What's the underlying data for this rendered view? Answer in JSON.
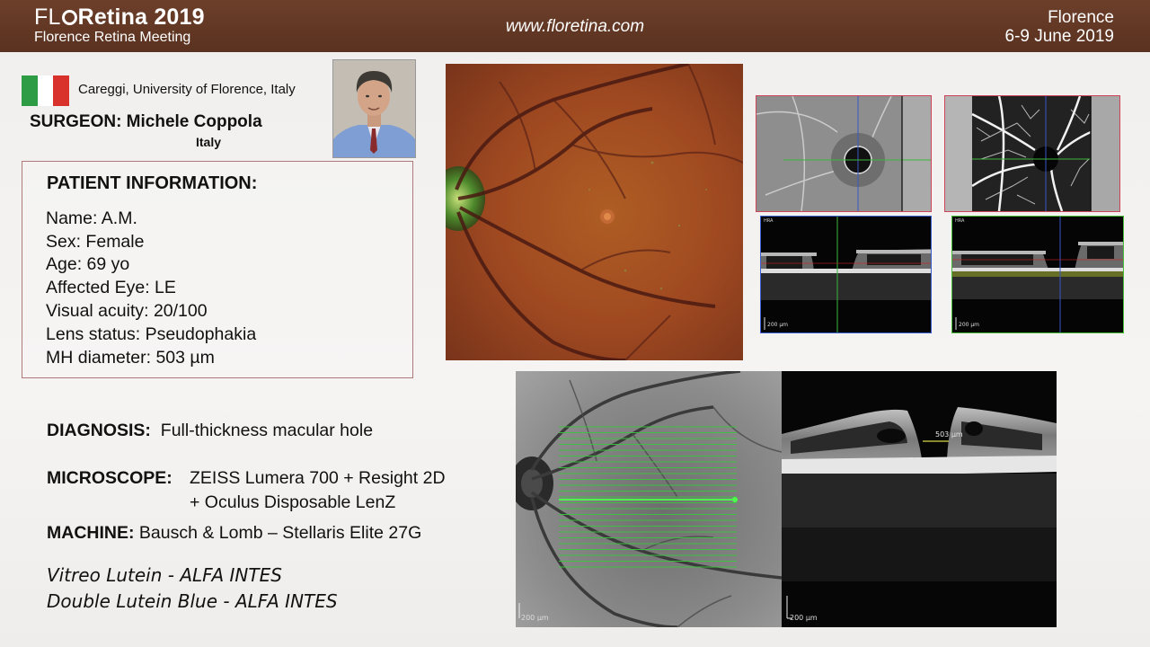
{
  "header": {
    "logo_prefix": "FL",
    "logo_o": "O",
    "logo_suffix": "Retina 2019",
    "logo_subtitle": "Florence Retina Meeting",
    "website": "www.floretina.com",
    "city": "Florence",
    "dates": "6-9 June 2019"
  },
  "presenter": {
    "institution": "Careggi, University of Florence, Italy",
    "surgeon": "SURGEON: Michele Coppola",
    "country": "Italy",
    "flag_colors": [
      "#2e9b45",
      "#ffffff",
      "#d9312b"
    ]
  },
  "patient": {
    "title": "PATIENT INFORMATION:",
    "lines": [
      "Name: A.M.",
      "Sex: Female",
      "Age: 69 yo",
      "Affected Eye: LE",
      "Visual acuity: 20/100",
      "Lens status: Pseudophakia",
      "MH diameter: 503 µm"
    ]
  },
  "case": {
    "diagnosis_label": "DIAGNOSIS:",
    "diagnosis_value": "Full-thickness macular hole",
    "microscope_label": "MICROSCOPE:",
    "microscope_value_1": "ZEISS Lumera 700 + Resight 2D",
    "microscope_value_2": "+ Oculus Disposable LenZ",
    "machine_label": "MACHINE:",
    "machine_value": "Bausch & Lomb – Stellaris Elite 27G",
    "dye_1": "Vitreo Lutein - ALFA INTES",
    "dye_2": "Double Lutein Blue - ALFA INTES"
  },
  "images": {
    "ir_scale": "200 µm",
    "oct_scale": "200 µm",
    "oct_measure": "503 µm",
    "bscan1_scale": "200 µm",
    "bscan2_scale": "200 µm"
  },
  "colors": {
    "header_bg": "#5f3624",
    "box_border": "#b07878",
    "octa_border": "#cc4455",
    "bscan1_border": "#3a5fd0",
    "bscan2_border": "#4cbf3a"
  }
}
